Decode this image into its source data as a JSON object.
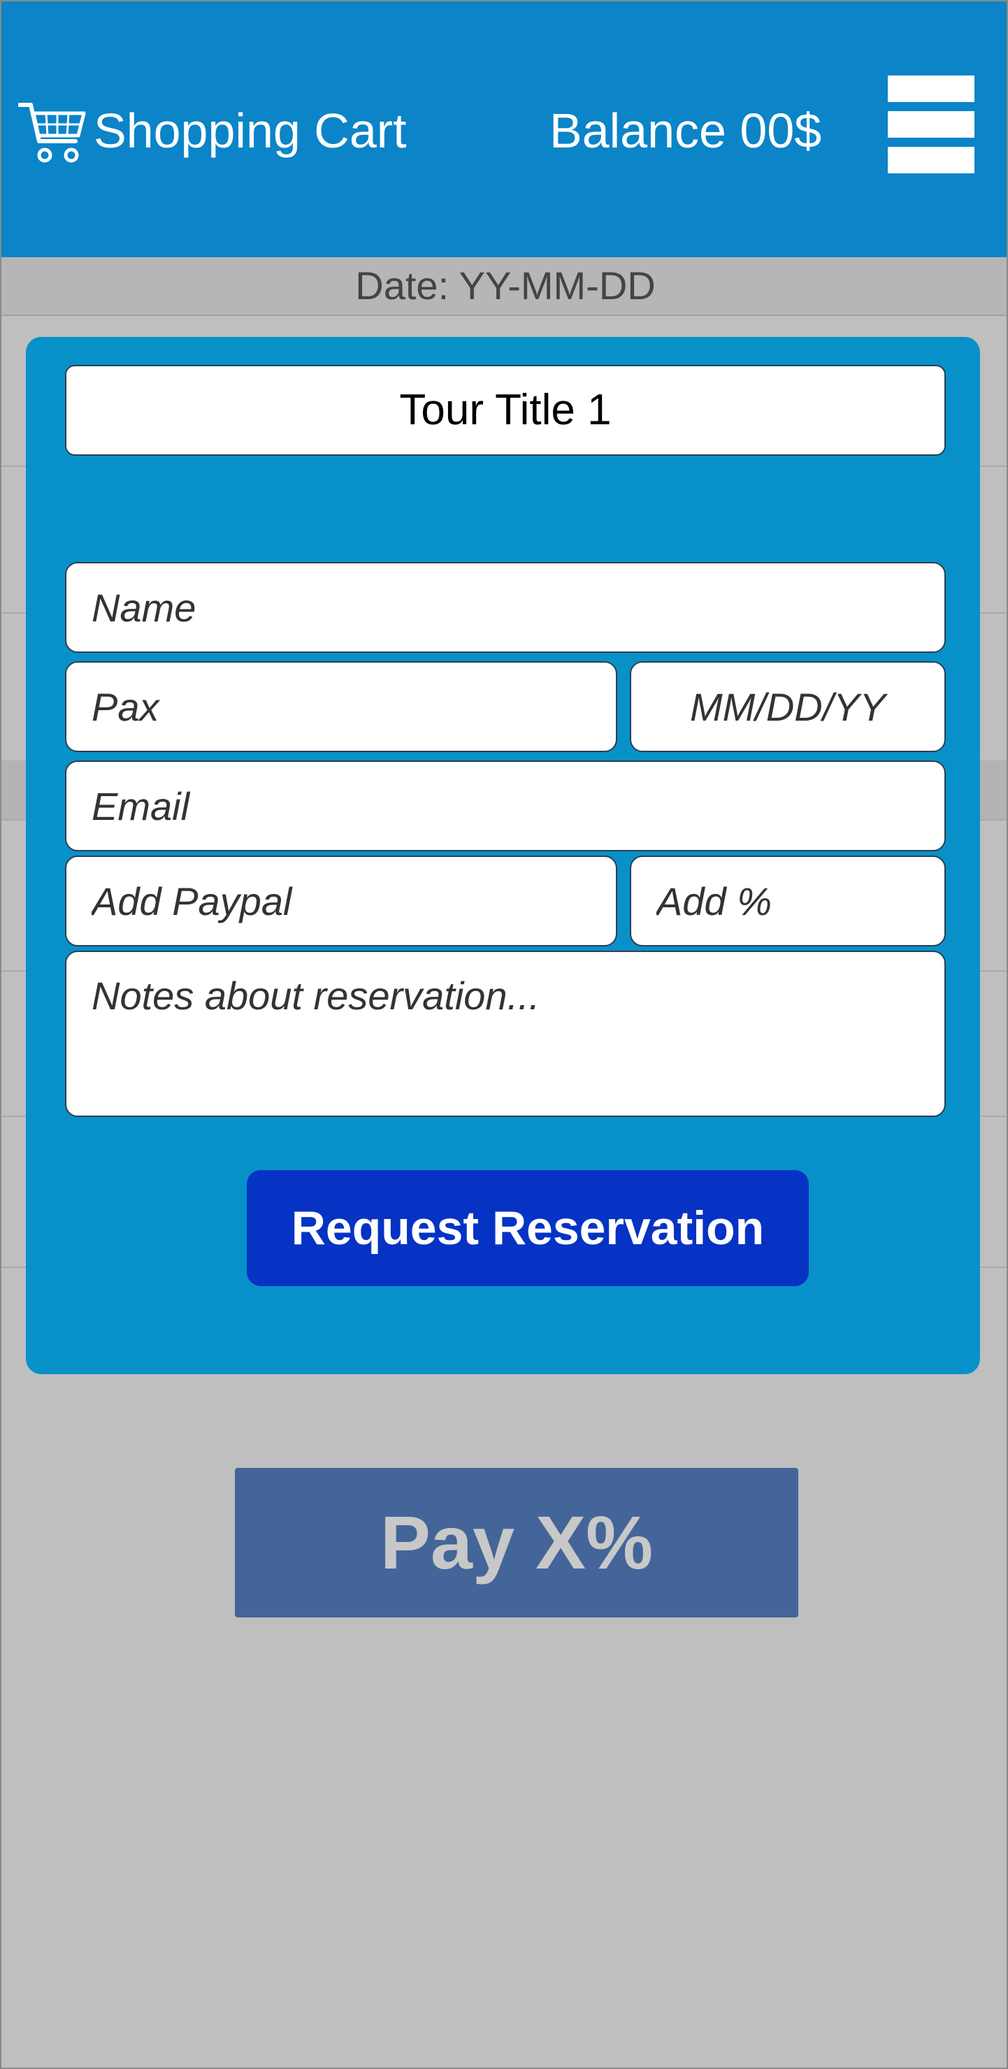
{
  "header": {
    "cart_label": "Shopping Cart",
    "balance_label": "Balance 00$",
    "cart_icon": "shopping-cart-icon",
    "menu_icon": "hamburger-menu-icon"
  },
  "date_bar": {
    "text": "Date: YY-MM-DD"
  },
  "modal": {
    "tour_title": "Tour Title 1",
    "fields": {
      "name_placeholder": "Name",
      "pax_placeholder": "Pax",
      "date_placeholder": "MM/DD/YY",
      "email_placeholder": "Email",
      "paypal_placeholder": "Add Paypal",
      "percent_placeholder": "Add %",
      "notes_placeholder": "Notes about reservation..."
    },
    "request_button_label": "Request Reservation"
  },
  "footer": {
    "pay_button_label": "Pay X%"
  },
  "colors": {
    "header": "#0b84c8",
    "modal": "#0891c9",
    "request_button": "#0633c4",
    "pay_button": "#436599",
    "background": "#bfbfbf"
  }
}
